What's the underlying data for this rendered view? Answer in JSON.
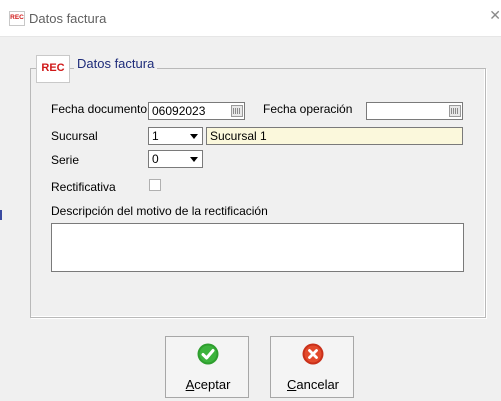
{
  "window": {
    "title": "Datos factura",
    "icon_text": "REC"
  },
  "group": {
    "legend": "Datos factura",
    "icon_text": "REC"
  },
  "fields": {
    "fecha_documento": {
      "label": "Fecha documento",
      "value": "06092023"
    },
    "fecha_operacion": {
      "label": "Fecha operación",
      "value": ""
    },
    "sucursal": {
      "label": "Sucursal",
      "value": "1",
      "name": "Sucursal 1"
    },
    "serie": {
      "label": "Serie",
      "value": "0"
    },
    "rectificativa": {
      "label": "Rectificativa",
      "checked": false
    },
    "descripcion": {
      "label": "Descripción del motivo de la rectificación",
      "value": ""
    }
  },
  "buttons": {
    "aceptar": {
      "accel": "A",
      "rest": "ceptar",
      "icon": "check-icon",
      "color": "#2e9e2e"
    },
    "cancelar": {
      "accel": "C",
      "rest": "ancelar",
      "icon": "cancel-icon",
      "color": "#d93a1e"
    }
  }
}
